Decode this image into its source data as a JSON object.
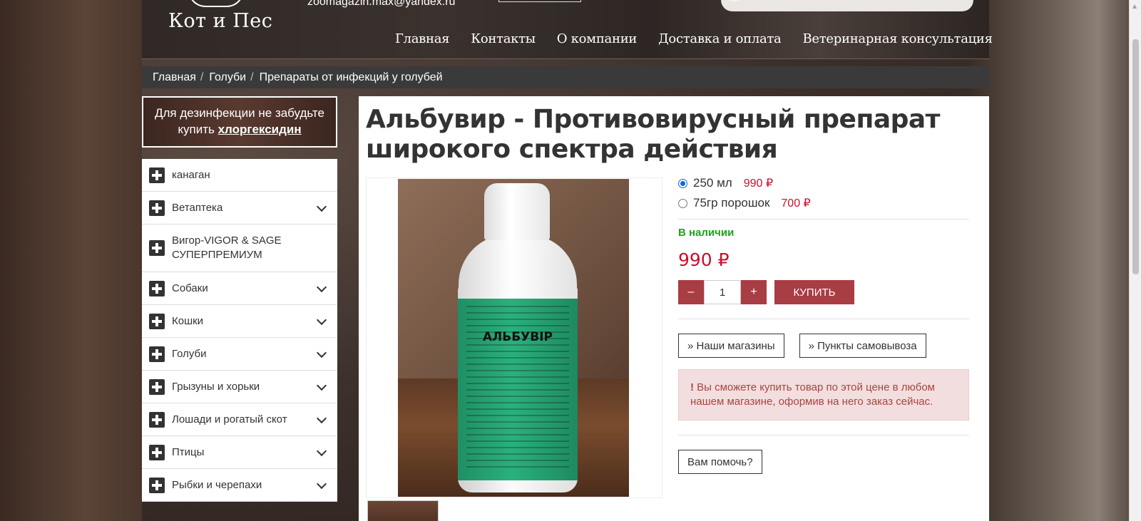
{
  "header": {
    "logo_text": "Кот и Пес",
    "email": "zoomagazin.max@yandex.ru",
    "nav": [
      "Главная",
      "Контакты",
      "О компании",
      "Доставка и оплата",
      "Ветеринарная консультация"
    ]
  },
  "breadcrumb": [
    "Главная",
    "Голуби",
    "Препараты от инфекций у голубей"
  ],
  "promo": {
    "text": "Для дезинфекции не забудьте купить ",
    "link": "хлоргексидин"
  },
  "categories": [
    {
      "label": "канаган",
      "has_sub": false
    },
    {
      "label": "Ветаптека",
      "has_sub": true
    },
    {
      "label": "Вигор-VIGOR & SAGE СУПЕРПРЕМИУМ",
      "has_sub": false
    },
    {
      "label": "Собаки",
      "has_sub": true
    },
    {
      "label": "Кошки",
      "has_sub": true
    },
    {
      "label": "Голуби",
      "has_sub": true
    },
    {
      "label": "Грызуны и хорьки",
      "has_sub": true
    },
    {
      "label": "Лошади и рогатый скот",
      "has_sub": true
    },
    {
      "label": "Птицы",
      "has_sub": true
    },
    {
      "label": "Рыбки и черепахи",
      "has_sub": true
    }
  ],
  "product": {
    "title": "Альбувир - Противовирусный препарат широкого спектра действия",
    "bottle_label": "АЛЬБУВІР",
    "options": [
      {
        "name": "250 мл",
        "price": "990 ₽",
        "selected": true
      },
      {
        "name": "75гр порошок",
        "price": "700 ₽",
        "selected": false
      }
    ],
    "stock": "В наличии",
    "price": "990 ₽",
    "qty": "1",
    "minus": "–",
    "plus": "+",
    "buy": "КУПИТЬ",
    "stores_btn": "» Наши магазины",
    "pickup_btn": "» Пункты самовывоза",
    "alert_mark": "!",
    "alert_text": " Вы сможете купить товар по этой цене в любом нашем магазине, оформив на него заказ сейчас.",
    "help_btn": "Вам помочь?"
  },
  "colors": {
    "accent": "#a83d43",
    "price": "#c8102e",
    "stock": "#1aa51a"
  }
}
